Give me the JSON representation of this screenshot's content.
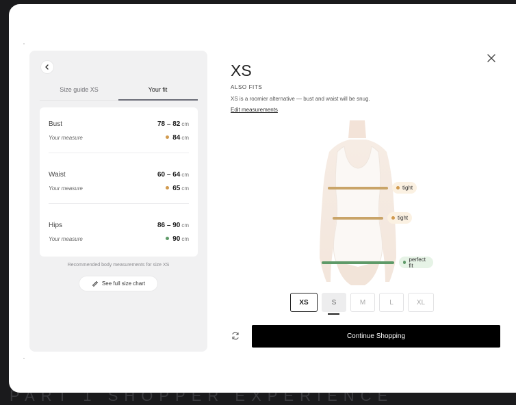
{
  "background_caption": "PART 1    SHOPPER EXPERIENCE",
  "left_panel": {
    "tabs": [
      {
        "label": "Size guide XS",
        "active": false
      },
      {
        "label": "Your fit",
        "active": true
      }
    ],
    "rows": [
      {
        "label": "Bust",
        "range": "78 – 82",
        "unit": "cm",
        "your_measure_label": "Your measure",
        "measure": "84",
        "status_color": "#d19a4f"
      },
      {
        "label": "Waist",
        "range": "60 – 64",
        "unit": "cm",
        "your_measure_label": "Your measure",
        "measure": "65",
        "status_color": "#d19a4f"
      },
      {
        "label": "Hips",
        "range": "86 – 90",
        "unit": "cm",
        "your_measure_label": "Your measure",
        "measure": "90",
        "status_color": "#5e9a68"
      }
    ],
    "recommendation": "Recommended body measurements for size XS",
    "size_chart_button": "See full size chart"
  },
  "right_panel": {
    "size": "XS",
    "also_fits": "ALSO FITS",
    "note": "XS is a roomier alternative — bust and waist will be snug.",
    "edit_link": "Edit measurements",
    "fit_tags": [
      {
        "label": "tight",
        "color": "#d19a4f",
        "bg": "#fbf1e2"
      },
      {
        "label": "tight",
        "color": "#d19a4f",
        "bg": "#fbf1e2"
      },
      {
        "label": "perfect fit",
        "color": "#5e9a68",
        "bg": "#e6f3e6"
      }
    ],
    "sizes": [
      {
        "label": "XS",
        "state": "selected"
      },
      {
        "label": "S",
        "state": "alternative"
      },
      {
        "label": "M",
        "state": "unavailable"
      },
      {
        "label": "L",
        "state": "unavailable"
      },
      {
        "label": "XL",
        "state": "unavailable"
      }
    ],
    "continue_label": "Continue Shopping"
  },
  "colors": {
    "tight": "#c9a468",
    "perfect": "#5e9a68",
    "primary_button": "#000000"
  }
}
